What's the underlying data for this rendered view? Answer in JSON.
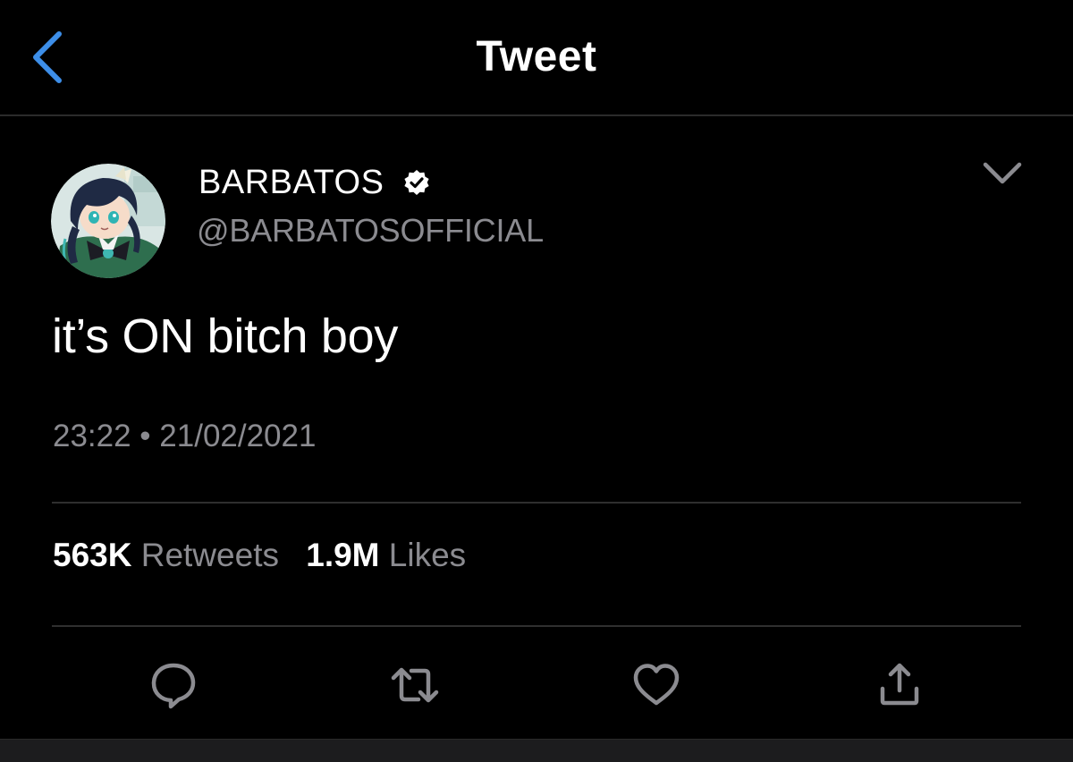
{
  "header": {
    "title": "Tweet",
    "back_icon": "chevron-left-icon"
  },
  "tweet": {
    "author": {
      "display_name": "BARBATOS",
      "handle": "@BARBATOSOFFICIAL",
      "verified": true
    },
    "menu_icon": "chevron-down-icon",
    "text": "it’s ON bitch boy",
    "timestamp": "23:22 • 21/02/2021",
    "stats": {
      "retweets_count": "563K",
      "retweets_label": "Retweets",
      "likes_count": "1.9M",
      "likes_label": "Likes"
    },
    "actions": [
      "reply-icon",
      "retweet-icon",
      "like-icon",
      "share-icon"
    ]
  },
  "colors": {
    "background": "#000000",
    "accent": "#3d8ee8",
    "text_primary": "#ffffff",
    "text_secondary": "#8b8b90",
    "divider": "#2f2f2f",
    "icon_gray": "#8b8b90"
  }
}
